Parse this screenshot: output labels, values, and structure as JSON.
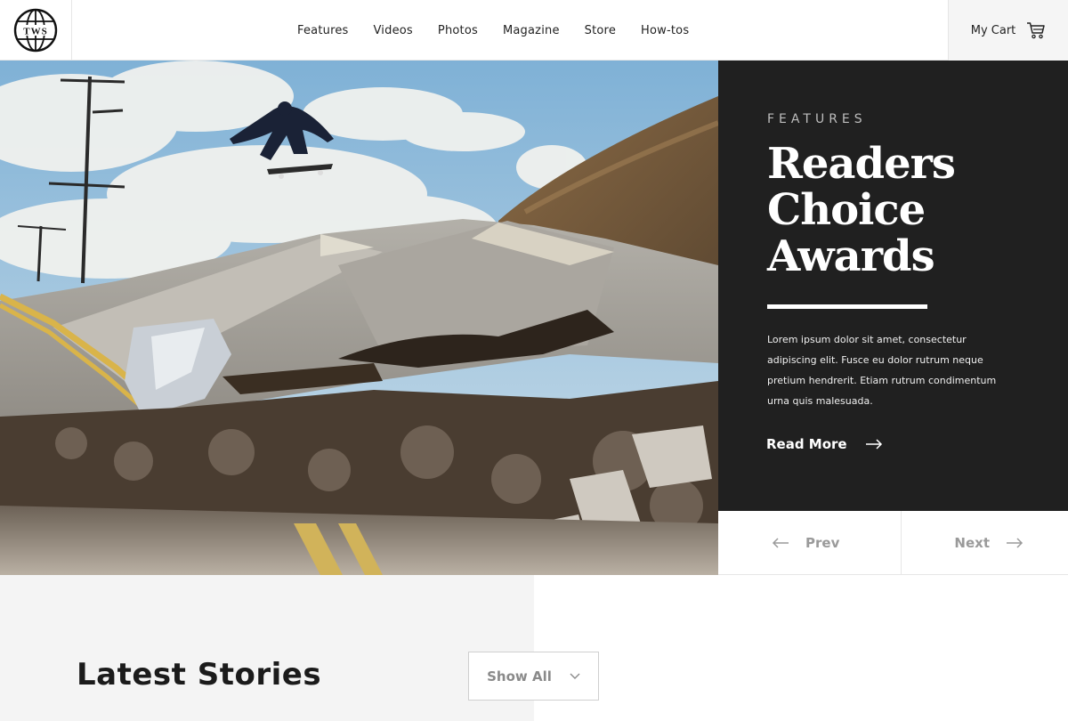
{
  "brand": {
    "logo_text": "TWS"
  },
  "nav": {
    "items": [
      {
        "label": "Features"
      },
      {
        "label": "Videos"
      },
      {
        "label": "Photos"
      },
      {
        "label": "Magazine"
      },
      {
        "label": "Store"
      },
      {
        "label": "How-tos"
      }
    ]
  },
  "cart": {
    "label": "My Cart",
    "icon": "cart-icon"
  },
  "feature": {
    "eyebrow": "FEATURES",
    "title": "Readers Choice Awards",
    "body": "Lorem ipsum dolor sit amet, consectetur adipiscing elit. Fusce eu dolor rutrum neque pretium hendrerit. Etiam rutrum condimentum urna quis malesuada.",
    "read_more": "Read More"
  },
  "pager": {
    "prev": "Prev",
    "next": "Next"
  },
  "stories": {
    "title": "Latest Stories",
    "show_all": "Show All"
  },
  "colors": {
    "panel": "#202020",
    "accent": "#ffffff",
    "muted": "#9a9a9a"
  }
}
